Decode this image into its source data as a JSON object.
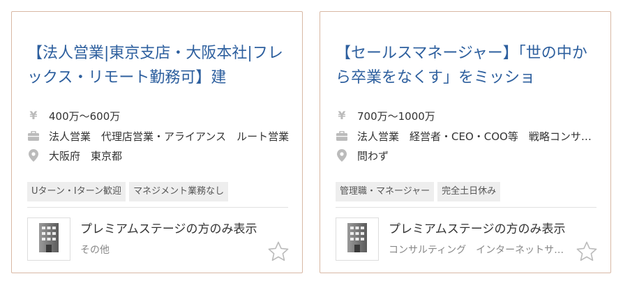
{
  "cards": [
    {
      "title": "【法人営業|東京支店・大阪本社|フレックス・リモート勤務可】建",
      "salary": "400万～600万",
      "job_type": "法人営業　代理店営業・アライアンス　ルート営業",
      "location": "大阪府　東京都",
      "tags": [
        "Uターン・Iターン歓迎",
        "マネジメント業務なし"
      ],
      "company_name": "プレミアムステージの方のみ表示",
      "industry": "その他",
      "icons": {
        "salary": "yen-icon",
        "job": "briefcase-icon",
        "location": "map-pin-icon",
        "logo": "building-icon",
        "favorite": "star-outline-icon"
      }
    },
    {
      "title": "【セールスマネージャー】「世の中から卒業をなくす」をミッショ",
      "salary": "700万～1000万",
      "job_type": "法人営業　経営者・CEO・COO等　戦略コンサルタント",
      "location": "問わず",
      "tags": [
        "管理職・マネージャー",
        "完全土日休み"
      ],
      "company_name": "プレミアムステージの方のみ表示",
      "industry": "コンサルティング　インターネットサービス",
      "icons": {
        "salary": "yen-icon",
        "job": "briefcase-icon",
        "location": "map-pin-icon",
        "logo": "building-icon",
        "favorite": "star-outline-icon"
      }
    }
  ],
  "colors": {
    "title": "#2d5f9e",
    "border": "#d8b8a4",
    "icon": "#bbbbbb",
    "tag_bg": "#eeeeee"
  }
}
